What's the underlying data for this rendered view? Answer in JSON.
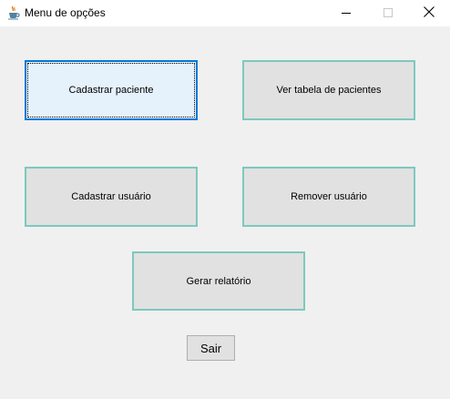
{
  "window": {
    "title": "Menu de opções",
    "controls": {
      "minimize_icon": "minimize-icon",
      "maximize_icon": "maximize-icon",
      "close_icon": "close-icon"
    }
  },
  "buttons": {
    "cadastrar_paciente": "Cadastrar paciente",
    "ver_tabela": "Ver tabela de pacientes",
    "cadastrar_usuario": "Cadastrar usuário",
    "remover_usuario": "Remover usuário",
    "gerar_relatorio": "Gerar relatório",
    "sair": "Sair"
  },
  "colors": {
    "button_border": "#7ec8bf",
    "focus_border": "#0078d7",
    "focus_background": "#e5f1fb",
    "window_background": "#f0f0f0"
  }
}
